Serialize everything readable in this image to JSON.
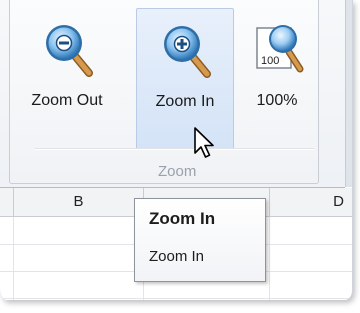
{
  "ribbon": {
    "group_label": "Zoom",
    "buttons": [
      {
        "label": "Zoom Out",
        "icon": "zoom-out-magnifier-icon"
      },
      {
        "label": "Zoom In",
        "icon": "zoom-in-magnifier-icon",
        "state": "hover"
      },
      {
        "label": "100%",
        "icon": "zoom-100-percent-icon",
        "icon_text": "100"
      }
    ]
  },
  "sheet": {
    "column_headers": [
      "B",
      "D"
    ]
  },
  "tooltip": {
    "title": "Zoom In",
    "description": "Zoom In"
  },
  "colors": {
    "hover_fill": "#d4e3f7",
    "hover_border": "#b9cbe5",
    "magnifier_lens": "#3a87c6",
    "magnifier_handle": "#c68a3e"
  }
}
